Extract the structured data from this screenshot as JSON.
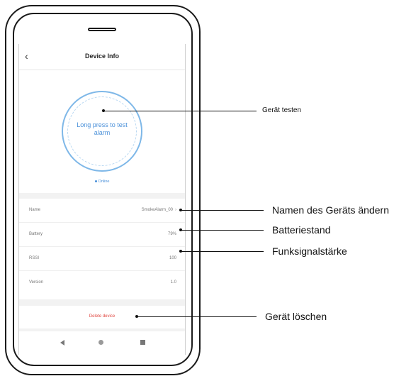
{
  "screen": {
    "back_icon": "chevron-left",
    "title": "Device Info",
    "test_button_text": "Long press to test alarm",
    "status": "Online",
    "rows": [
      {
        "label": "Name",
        "value": "SmokeAlarm_00",
        "has_chevron": true
      },
      {
        "label": "Battery",
        "value": "79%"
      },
      {
        "label": "RSSI",
        "value": "100"
      },
      {
        "label": "Version",
        "value": "1.0"
      }
    ],
    "delete_label": "Delete device",
    "nav_icons": [
      "back-triangle",
      "home-circle",
      "recent-square"
    ]
  },
  "callouts": {
    "test": "Gerät testen",
    "rename": "Namen des Geräts ändern",
    "battery": "Batteriestand",
    "signal": "Funksignalstärke",
    "delete": "Gerät löschen"
  },
  "colors": {
    "accent": "#4a90d9",
    "ring": "#7fb8e8",
    "danger": "#e0443e",
    "screen_bg": "#f2f2f2"
  }
}
